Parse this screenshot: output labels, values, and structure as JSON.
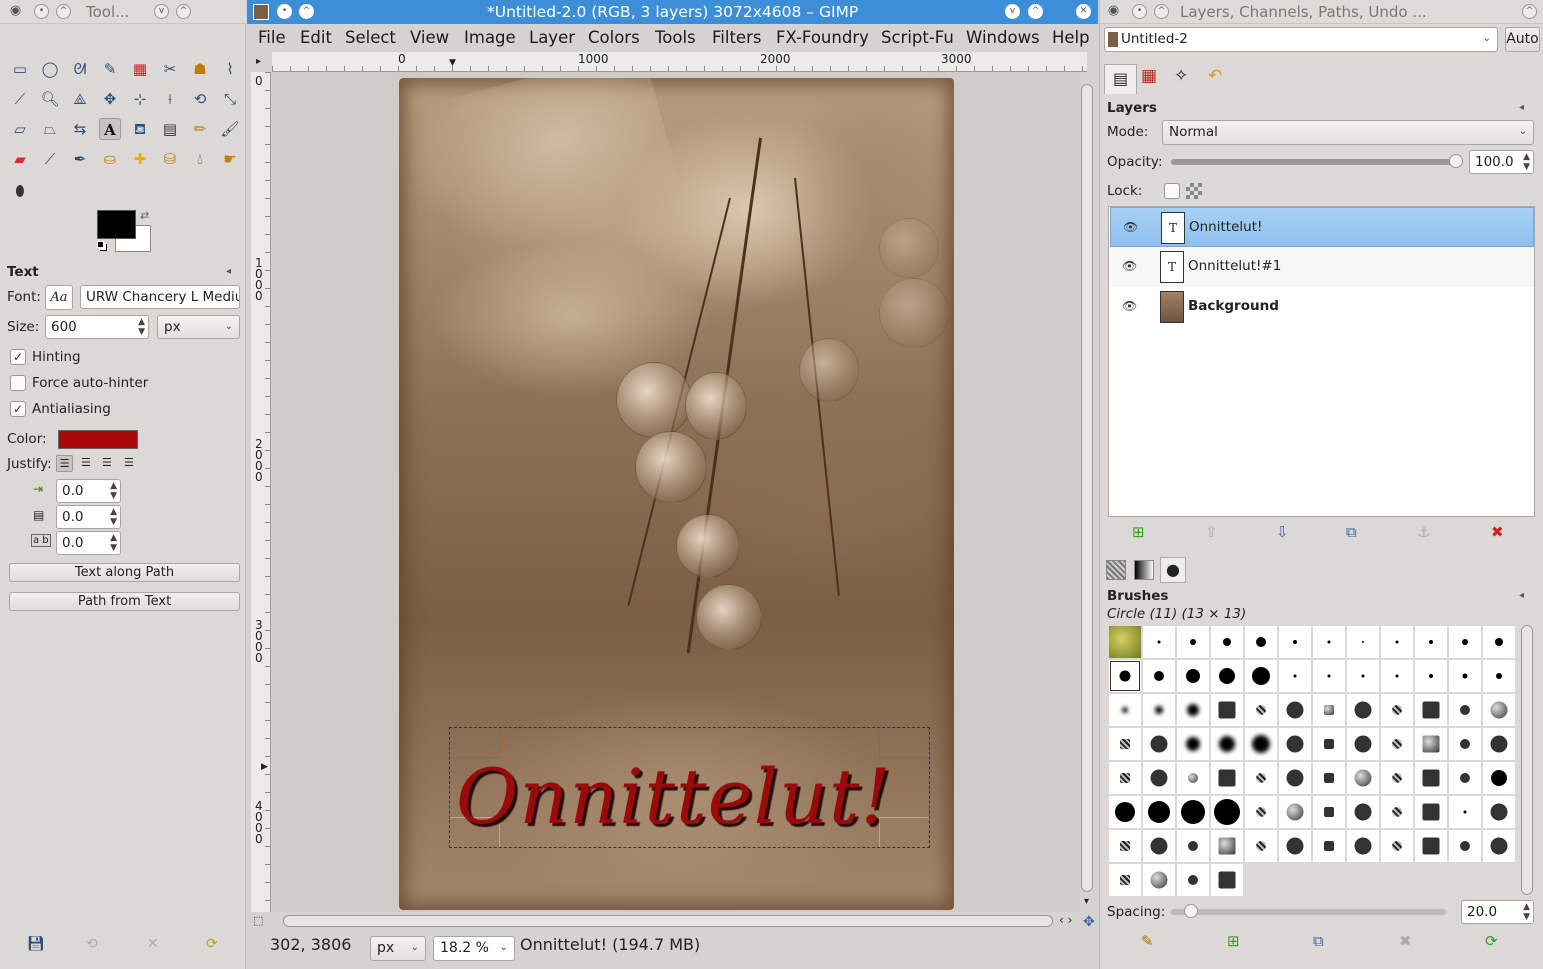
{
  "toolbox": {
    "title": "Tool...",
    "text_options": {
      "header": "Text",
      "font_label": "Font:",
      "font_preview": "Aa",
      "font_value": "URW Chancery L Medium",
      "size_label": "Size:",
      "size_value": "600",
      "size_unit": "px",
      "hinting": "Hinting",
      "force_autohinter": "Force auto-hinter",
      "antialiasing": "Antialiasing",
      "color_label": "Color:",
      "text_color": "#a80808",
      "justify_label": "Justify:",
      "indent": "0.0",
      "line_spacing": "0.0",
      "letter_spacing": "0.0",
      "text_along_path": "Text along Path",
      "path_from_text": "Path from Text"
    }
  },
  "image_window": {
    "title": "*Untitled-2.0 (RGB, 3 layers) 3072x4608 – GIMP",
    "menu": [
      "File",
      "Edit",
      "Select",
      "View",
      "Image",
      "Layer",
      "Colors",
      "Tools",
      "Filters",
      "FX-Foundry",
      "Script-Fu",
      "Windows",
      "Help"
    ],
    "ruler_h": [
      "0",
      "1000",
      "2000",
      "3000"
    ],
    "ruler_v": [
      "0",
      "1\n0\n0\n0",
      "2\n0\n0\n0",
      "3\n0\n0\n0",
      "4\n0\n0\n0"
    ],
    "canvas_text": "Onnittelut!",
    "status": {
      "coords": "302, 3806",
      "unit": "px",
      "zoom": "18.2 %",
      "message": "Onnittelut! (194.7 MB)"
    }
  },
  "dock": {
    "title": "Layers, Channels, Paths, Undo ...",
    "image_select": "Untitled-2",
    "auto_label": "Auto",
    "layers": {
      "header": "Layers",
      "mode_label": "Mode:",
      "mode_value": "Normal",
      "opacity_label": "Opacity:",
      "opacity_value": "100.0",
      "opacity_fraction": 1.0,
      "lock_label": "Lock:",
      "items": [
        {
          "name": "Onnittelut!"
        },
        {
          "name": "Onnittelut!#1"
        },
        {
          "name": "Background"
        }
      ]
    },
    "brushes": {
      "header": "Brushes",
      "selected": "Circle (11) (13 × 13)",
      "spacing_label": "Spacing:",
      "spacing_value": "20.0"
    }
  }
}
